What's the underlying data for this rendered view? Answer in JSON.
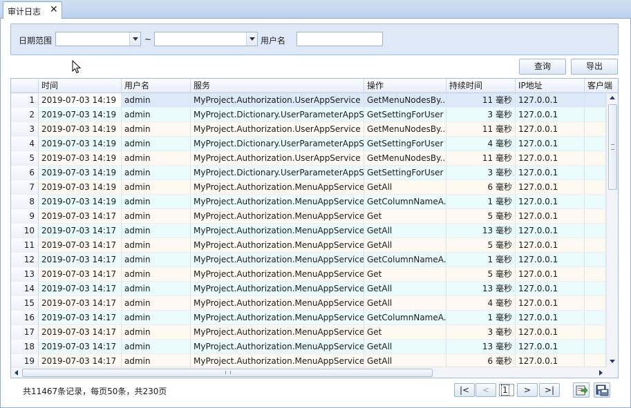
{
  "tab": {
    "label": "审计日志",
    "close": "✕"
  },
  "filter": {
    "date_range_label": "日期范围",
    "date_from": "",
    "date_sep": "~",
    "date_to": "",
    "username_label": "用户名",
    "username": ""
  },
  "actions": {
    "query": "查询",
    "export": "导出"
  },
  "grid": {
    "columns": [
      "时间",
      "用户名",
      "服务",
      "操作",
      "持续时间",
      "IP地址",
      "客户端"
    ],
    "rows": [
      {
        "n": "1",
        "time": "2019-07-03 14:19",
        "user": "admin",
        "service": "MyProject.Authorization.UserAppService",
        "op": "GetMenuNodesBy...",
        "dur": "11 毫秒",
        "ip": "127.0.0.1"
      },
      {
        "n": "2",
        "time": "2019-07-03 14:19",
        "user": "admin",
        "service": "MyProject.Dictionary.UserParameterAppS...",
        "op": "GetSettingForUser",
        "dur": "3 毫秒",
        "ip": "127.0.0.1"
      },
      {
        "n": "3",
        "time": "2019-07-03 14:19",
        "user": "admin",
        "service": "MyProject.Authorization.UserAppService",
        "op": "GetMenuNodesBy...",
        "dur": "11 毫秒",
        "ip": "127.0.0.1"
      },
      {
        "n": "4",
        "time": "2019-07-03 14:19",
        "user": "admin",
        "service": "MyProject.Dictionary.UserParameterAppS...",
        "op": "GetSettingForUser",
        "dur": "4 毫秒",
        "ip": "127.0.0.1"
      },
      {
        "n": "5",
        "time": "2019-07-03 14:19",
        "user": "admin",
        "service": "MyProject.Authorization.UserAppService",
        "op": "GetMenuNodesBy...",
        "dur": "11 毫秒",
        "ip": "127.0.0.1"
      },
      {
        "n": "6",
        "time": "2019-07-03 14:19",
        "user": "admin",
        "service": "MyProject.Dictionary.UserParameterAppS...",
        "op": "GetSettingForUser",
        "dur": "3 毫秒",
        "ip": "127.0.0.1"
      },
      {
        "n": "7",
        "time": "2019-07-03 14:19",
        "user": "admin",
        "service": "MyProject.Authorization.MenuAppService",
        "op": "GetAll",
        "dur": "6 毫秒",
        "ip": "127.0.0.1"
      },
      {
        "n": "8",
        "time": "2019-07-03 14:19",
        "user": "admin",
        "service": "MyProject.Authorization.MenuAppService",
        "op": "GetColumnNameA...",
        "dur": "1 毫秒",
        "ip": "127.0.0.1"
      },
      {
        "n": "9",
        "time": "2019-07-03 14:17",
        "user": "admin",
        "service": "MyProject.Authorization.MenuAppService",
        "op": "Get",
        "dur": "5 毫秒",
        "ip": "127.0.0.1"
      },
      {
        "n": "10",
        "time": "2019-07-03 14:17",
        "user": "admin",
        "service": "MyProject.Authorization.MenuAppService",
        "op": "GetAll",
        "dur": "13 毫秒",
        "ip": "127.0.0.1"
      },
      {
        "n": "11",
        "time": "2019-07-03 14:17",
        "user": "admin",
        "service": "MyProject.Authorization.MenuAppService",
        "op": "GetAll",
        "dur": "5 毫秒",
        "ip": "127.0.0.1"
      },
      {
        "n": "12",
        "time": "2019-07-03 14:17",
        "user": "admin",
        "service": "MyProject.Authorization.MenuAppService",
        "op": "GetColumnNameA...",
        "dur": "1 毫秒",
        "ip": "127.0.0.1"
      },
      {
        "n": "13",
        "time": "2019-07-03 14:17",
        "user": "admin",
        "service": "MyProject.Authorization.MenuAppService",
        "op": "Get",
        "dur": "5 毫秒",
        "ip": "127.0.0.1"
      },
      {
        "n": "14",
        "time": "2019-07-03 14:17",
        "user": "admin",
        "service": "MyProject.Authorization.MenuAppService",
        "op": "GetAll",
        "dur": "13 毫秒",
        "ip": "127.0.0.1"
      },
      {
        "n": "15",
        "time": "2019-07-03 14:17",
        "user": "admin",
        "service": "MyProject.Authorization.MenuAppService",
        "op": "GetAll",
        "dur": "4 毫秒",
        "ip": "127.0.0.1"
      },
      {
        "n": "16",
        "time": "2019-07-03 14:17",
        "user": "admin",
        "service": "MyProject.Authorization.MenuAppService",
        "op": "GetColumnNameA...",
        "dur": "1 毫秒",
        "ip": "127.0.0.1"
      },
      {
        "n": "17",
        "time": "2019-07-03 14:17",
        "user": "admin",
        "service": "MyProject.Authorization.MenuAppService",
        "op": "Get",
        "dur": "3 毫秒",
        "ip": "127.0.0.1"
      },
      {
        "n": "18",
        "time": "2019-07-03 14:17",
        "user": "admin",
        "service": "MyProject.Authorization.MenuAppService",
        "op": "GetAll",
        "dur": "13 毫秒",
        "ip": "127.0.0.1"
      },
      {
        "n": "19",
        "time": "2019-07-03 14:17",
        "user": "admin",
        "service": "MyProject.Authorization.MenuAppService",
        "op": "GetAll",
        "dur": "6 毫秒",
        "ip": "127.0.0.1"
      }
    ]
  },
  "footer": {
    "status": "共11467条记录，每页50条，共230页",
    "first": "|<",
    "prev": "<",
    "page": "1",
    "next": ">",
    "last": ">|"
  },
  "icons": {
    "footer_export": "export-icon",
    "footer_save": "save-icon",
    "cursor": "mouse-cursor-icon"
  }
}
